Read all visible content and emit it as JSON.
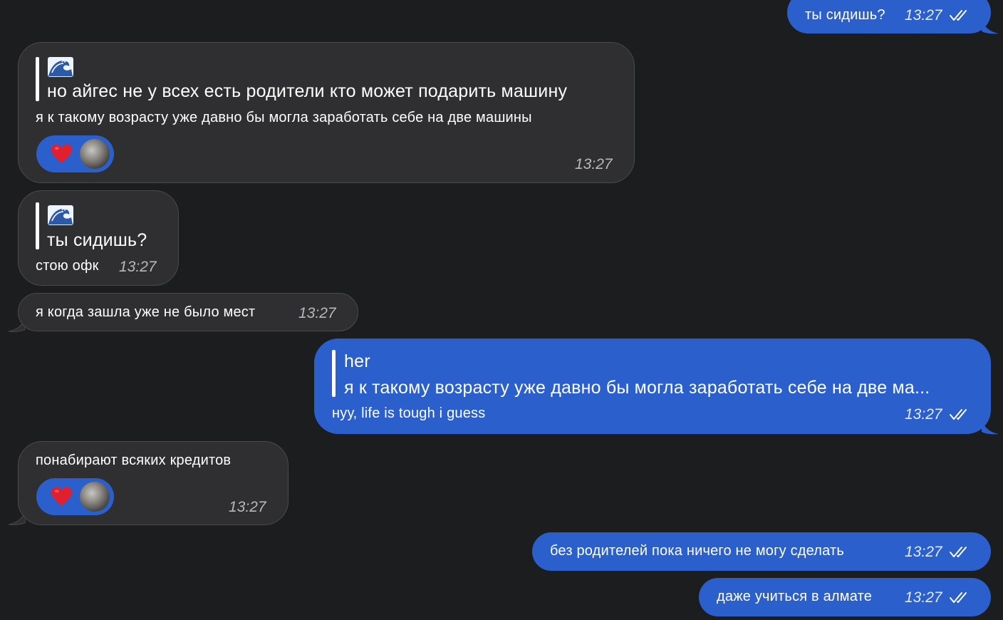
{
  "colors": {
    "background": "#1c1d1f",
    "incoming": "#2f2f31",
    "outgoing": "#2b5fcb",
    "heart": "#e0202f"
  },
  "messages": {
    "m1": {
      "text": "ты сидишь?",
      "time": "13:27"
    },
    "m2": {
      "quote_icon": "wave-emoji",
      "quote_text": "но айгес не у всех есть родители кто может подарить машину",
      "text": "я к такому возрасту уже давно бы могла заработать себе на две машины",
      "reaction": "heart",
      "time": "13:27"
    },
    "m3": {
      "quote_icon": "wave-emoji",
      "quote_text": "ты сидишь?",
      "text": "стою офк",
      "time": "13:27"
    },
    "m4": {
      "text": "я когда зашла уже не было мест",
      "time": "13:27"
    },
    "m5": {
      "quote_author": "her",
      "quote_text": "я к такому возрасту уже давно бы могла заработать себе на две ма...",
      "text": "нуу, life is tough i guess",
      "time": "13:27"
    },
    "m6": {
      "text": "понабирают всяких кредитов",
      "reaction": "heart",
      "time": "13:27"
    },
    "m7": {
      "text": "без родителей пока ничего не могу сделать",
      "time": "13:27"
    },
    "m8": {
      "text": "даже учиться в алмате",
      "time": "13:27"
    }
  }
}
